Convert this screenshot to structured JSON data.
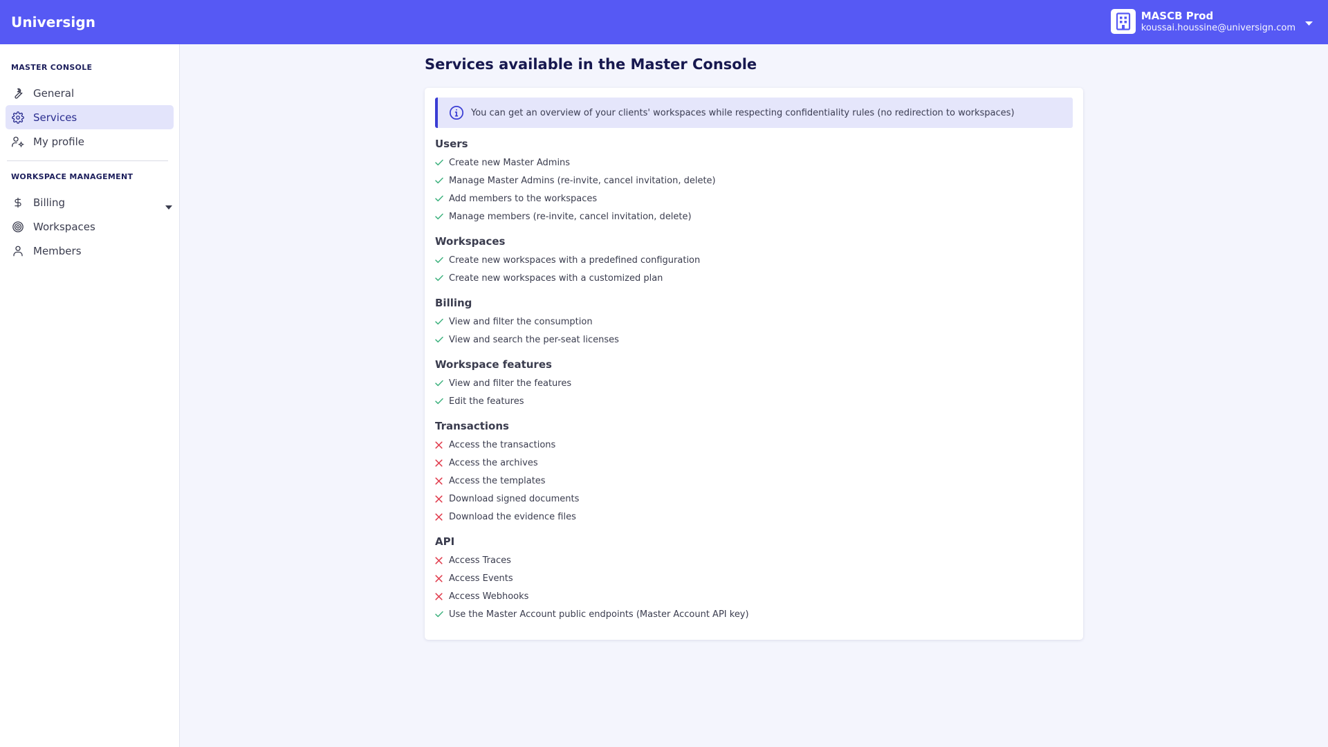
{
  "header": {
    "brand": "Universign",
    "account": {
      "org_name": "MASCB Prod",
      "email": "koussai.houssine@universign.com"
    }
  },
  "sidebar": {
    "sections": [
      {
        "title": "MASTER CONSOLE",
        "items": [
          {
            "label": "General",
            "icon": "wrench-icon",
            "active": false
          },
          {
            "label": "Services",
            "icon": "gear-icon",
            "active": true
          },
          {
            "label": "My profile",
            "icon": "user-settings-icon",
            "active": false
          }
        ]
      },
      {
        "title": "WORKSPACE MANAGEMENT",
        "items": [
          {
            "label": "Billing",
            "icon": "dollar-icon",
            "active": false,
            "expandable": true
          },
          {
            "label": "Workspaces",
            "icon": "target-icon",
            "active": false
          },
          {
            "label": "Members",
            "icon": "user-icon",
            "active": false
          }
        ]
      }
    ]
  },
  "main": {
    "title": "Services available in the Master Console",
    "info": "You can get an overview of your clients' workspaces while respecting confidentiality rules (no redirection to workspaces)",
    "groups": [
      {
        "title": "Users",
        "items": [
          {
            "label": "Create new Master Admins",
            "allowed": true
          },
          {
            "label": "Manage Master Admins (re-invite, cancel invitation, delete)",
            "allowed": true
          },
          {
            "label": "Add members to the workspaces",
            "allowed": true
          },
          {
            "label": "Manage members (re-invite, cancel invitation, delete)",
            "allowed": true
          }
        ]
      },
      {
        "title": "Workspaces",
        "items": [
          {
            "label": "Create new workspaces with a predefined configuration",
            "allowed": true
          },
          {
            "label": "Create new workspaces with a customized plan",
            "allowed": true
          }
        ]
      },
      {
        "title": "Billing",
        "items": [
          {
            "label": "View and filter the consumption",
            "allowed": true
          },
          {
            "label": "View and search the per-seat licenses",
            "allowed": true
          }
        ]
      },
      {
        "title": "Workspace features",
        "items": [
          {
            "label": "View and filter the features",
            "allowed": true
          },
          {
            "label": "Edit the features",
            "allowed": true
          }
        ]
      },
      {
        "title": "Transactions",
        "items": [
          {
            "label": "Access the transactions",
            "allowed": false
          },
          {
            "label": "Access the archives",
            "allowed": false
          },
          {
            "label": "Access the templates",
            "allowed": false
          },
          {
            "label": "Download signed documents",
            "allowed": false
          },
          {
            "label": "Download the evidence files",
            "allowed": false
          }
        ]
      },
      {
        "title": "API",
        "items": [
          {
            "label": "Access Traces",
            "allowed": false
          },
          {
            "label": "Access Events",
            "allowed": false
          },
          {
            "label": "Access Webhooks",
            "allowed": false
          },
          {
            "label": "Use the Master Account public endpoints (Master Account API key)",
            "allowed": true
          }
        ]
      }
    ]
  },
  "colors": {
    "header": "#5659f4",
    "allowed": "#3fb27f",
    "denied": "#e0394a",
    "accent": "#3a3dd4"
  }
}
